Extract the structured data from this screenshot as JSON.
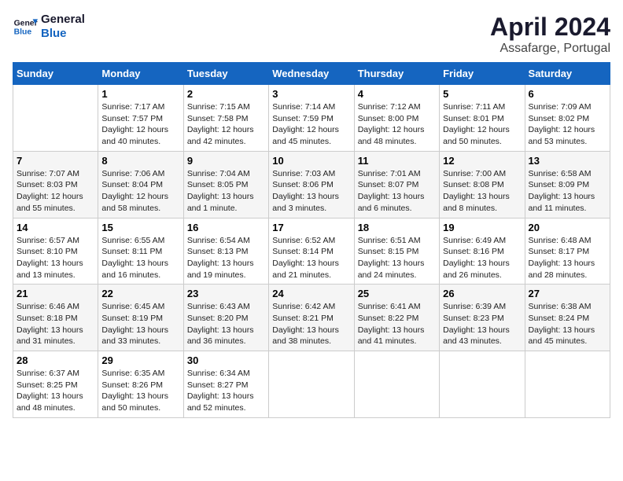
{
  "header": {
    "logo_line1": "General",
    "logo_line2": "Blue",
    "title": "April 2024",
    "subtitle": "Assafarge, Portugal"
  },
  "calendar": {
    "days_of_week": [
      "Sunday",
      "Monday",
      "Tuesday",
      "Wednesday",
      "Thursday",
      "Friday",
      "Saturday"
    ],
    "weeks": [
      [
        {
          "day": "",
          "info": ""
        },
        {
          "day": "1",
          "info": "Sunrise: 7:17 AM\nSunset: 7:57 PM\nDaylight: 12 hours\nand 40 minutes."
        },
        {
          "day": "2",
          "info": "Sunrise: 7:15 AM\nSunset: 7:58 PM\nDaylight: 12 hours\nand 42 minutes."
        },
        {
          "day": "3",
          "info": "Sunrise: 7:14 AM\nSunset: 7:59 PM\nDaylight: 12 hours\nand 45 minutes."
        },
        {
          "day": "4",
          "info": "Sunrise: 7:12 AM\nSunset: 8:00 PM\nDaylight: 12 hours\nand 48 minutes."
        },
        {
          "day": "5",
          "info": "Sunrise: 7:11 AM\nSunset: 8:01 PM\nDaylight: 12 hours\nand 50 minutes."
        },
        {
          "day": "6",
          "info": "Sunrise: 7:09 AM\nSunset: 8:02 PM\nDaylight: 12 hours\nand 53 minutes."
        }
      ],
      [
        {
          "day": "7",
          "info": "Sunrise: 7:07 AM\nSunset: 8:03 PM\nDaylight: 12 hours\nand 55 minutes."
        },
        {
          "day": "8",
          "info": "Sunrise: 7:06 AM\nSunset: 8:04 PM\nDaylight: 12 hours\nand 58 minutes."
        },
        {
          "day": "9",
          "info": "Sunrise: 7:04 AM\nSunset: 8:05 PM\nDaylight: 13 hours\nand 1 minute."
        },
        {
          "day": "10",
          "info": "Sunrise: 7:03 AM\nSunset: 8:06 PM\nDaylight: 13 hours\nand 3 minutes."
        },
        {
          "day": "11",
          "info": "Sunrise: 7:01 AM\nSunset: 8:07 PM\nDaylight: 13 hours\nand 6 minutes."
        },
        {
          "day": "12",
          "info": "Sunrise: 7:00 AM\nSunset: 8:08 PM\nDaylight: 13 hours\nand 8 minutes."
        },
        {
          "day": "13",
          "info": "Sunrise: 6:58 AM\nSunset: 8:09 PM\nDaylight: 13 hours\nand 11 minutes."
        }
      ],
      [
        {
          "day": "14",
          "info": "Sunrise: 6:57 AM\nSunset: 8:10 PM\nDaylight: 13 hours\nand 13 minutes."
        },
        {
          "day": "15",
          "info": "Sunrise: 6:55 AM\nSunset: 8:11 PM\nDaylight: 13 hours\nand 16 minutes."
        },
        {
          "day": "16",
          "info": "Sunrise: 6:54 AM\nSunset: 8:13 PM\nDaylight: 13 hours\nand 19 minutes."
        },
        {
          "day": "17",
          "info": "Sunrise: 6:52 AM\nSunset: 8:14 PM\nDaylight: 13 hours\nand 21 minutes."
        },
        {
          "day": "18",
          "info": "Sunrise: 6:51 AM\nSunset: 8:15 PM\nDaylight: 13 hours\nand 24 minutes."
        },
        {
          "day": "19",
          "info": "Sunrise: 6:49 AM\nSunset: 8:16 PM\nDaylight: 13 hours\nand 26 minutes."
        },
        {
          "day": "20",
          "info": "Sunrise: 6:48 AM\nSunset: 8:17 PM\nDaylight: 13 hours\nand 28 minutes."
        }
      ],
      [
        {
          "day": "21",
          "info": "Sunrise: 6:46 AM\nSunset: 8:18 PM\nDaylight: 13 hours\nand 31 minutes."
        },
        {
          "day": "22",
          "info": "Sunrise: 6:45 AM\nSunset: 8:19 PM\nDaylight: 13 hours\nand 33 minutes."
        },
        {
          "day": "23",
          "info": "Sunrise: 6:43 AM\nSunset: 8:20 PM\nDaylight: 13 hours\nand 36 minutes."
        },
        {
          "day": "24",
          "info": "Sunrise: 6:42 AM\nSunset: 8:21 PM\nDaylight: 13 hours\nand 38 minutes."
        },
        {
          "day": "25",
          "info": "Sunrise: 6:41 AM\nSunset: 8:22 PM\nDaylight: 13 hours\nand 41 minutes."
        },
        {
          "day": "26",
          "info": "Sunrise: 6:39 AM\nSunset: 8:23 PM\nDaylight: 13 hours\nand 43 minutes."
        },
        {
          "day": "27",
          "info": "Sunrise: 6:38 AM\nSunset: 8:24 PM\nDaylight: 13 hours\nand 45 minutes."
        }
      ],
      [
        {
          "day": "28",
          "info": "Sunrise: 6:37 AM\nSunset: 8:25 PM\nDaylight: 13 hours\nand 48 minutes."
        },
        {
          "day": "29",
          "info": "Sunrise: 6:35 AM\nSunset: 8:26 PM\nDaylight: 13 hours\nand 50 minutes."
        },
        {
          "day": "30",
          "info": "Sunrise: 6:34 AM\nSunset: 8:27 PM\nDaylight: 13 hours\nand 52 minutes."
        },
        {
          "day": "",
          "info": ""
        },
        {
          "day": "",
          "info": ""
        },
        {
          "day": "",
          "info": ""
        },
        {
          "day": "",
          "info": ""
        }
      ]
    ]
  }
}
